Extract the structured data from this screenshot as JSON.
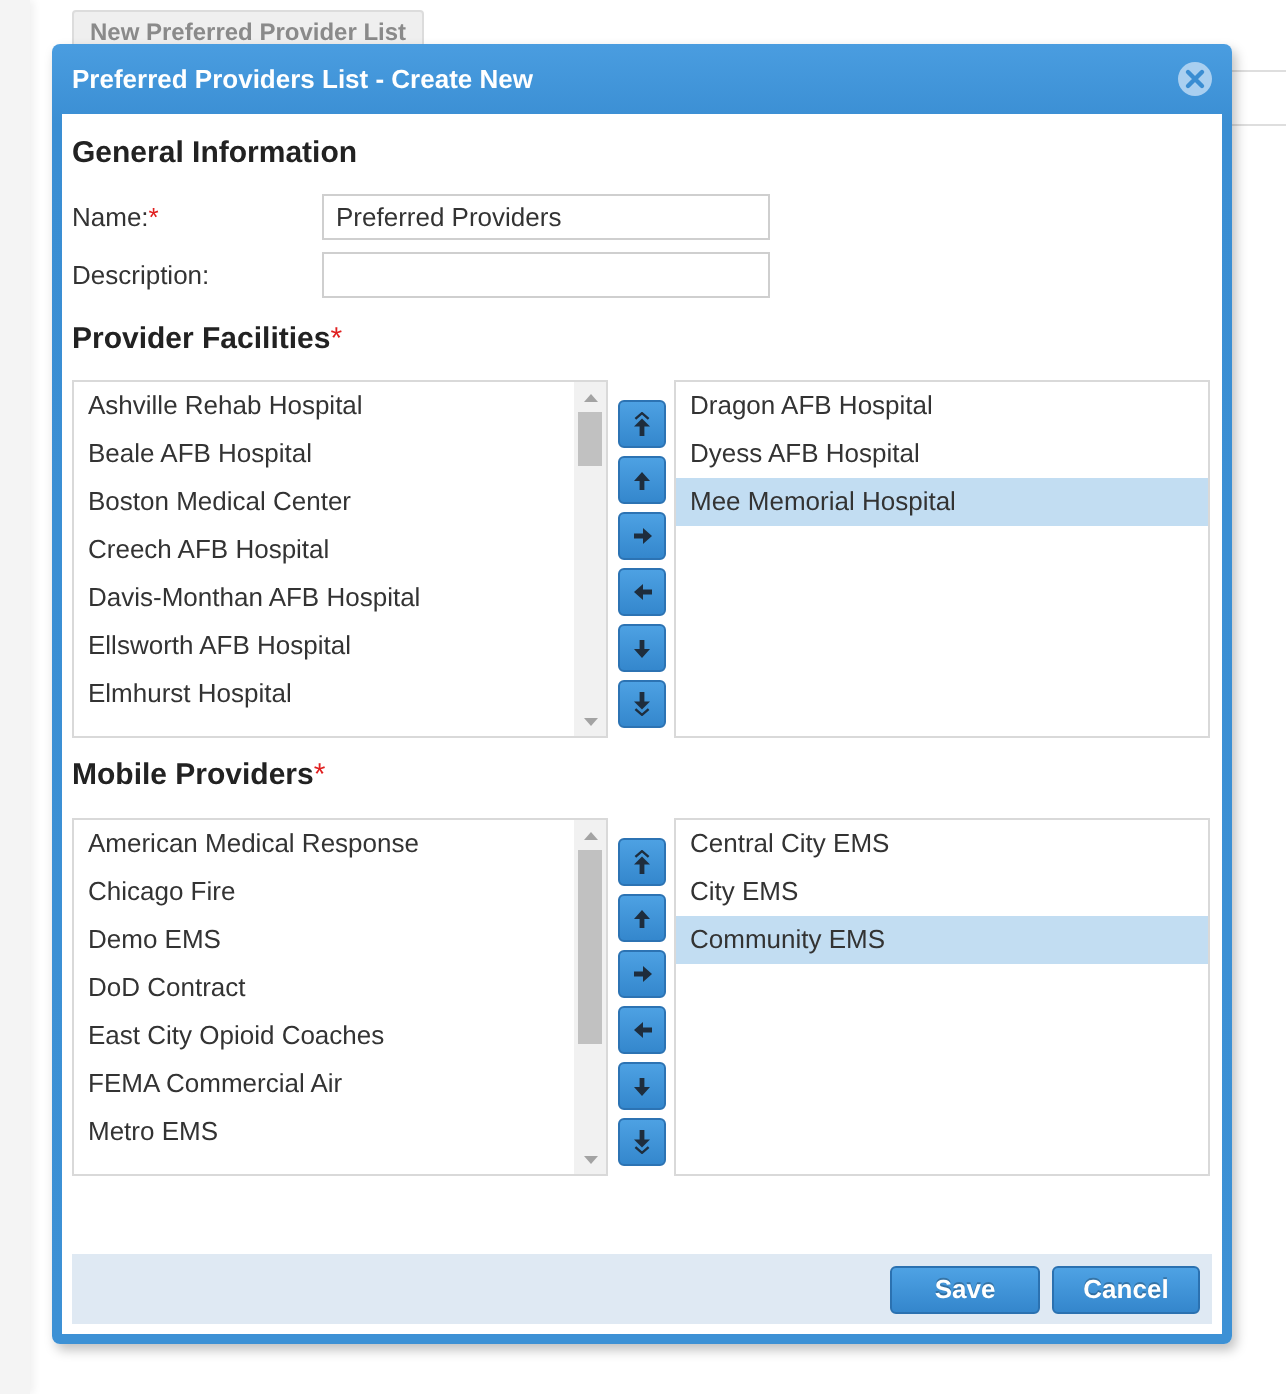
{
  "background": {
    "button": "New Preferred Provider List"
  },
  "dialog": {
    "title": "Preferred Providers List - Create New",
    "sections": [
      {
        "kind": "form",
        "heading": "General Information",
        "fields": [
          {
            "label": "Name:",
            "required_mark": "*",
            "value": "Preferred Providers"
          },
          {
            "label": "Description:"
          }
        ]
      },
      {
        "kind": "picklist",
        "heading": "Provider Facilities",
        "required_mark": "*",
        "available": [
          {
            "label": "Ashville Rehab Hospital",
            "selected": false
          },
          {
            "label": "Beale AFB Hospital",
            "selected": false
          },
          {
            "label": "Boston Medical Center",
            "selected": false
          },
          {
            "label": "Creech AFB Hospital",
            "selected": false
          },
          {
            "label": "Davis-Monthan AFB Hospital",
            "selected": false
          },
          {
            "label": "Ellsworth AFB Hospital",
            "selected": false
          },
          {
            "label": "Elmhurst Hospital",
            "selected": false
          }
        ],
        "chosen": [
          {
            "label": "Dragon AFB Hospital",
            "selected": false
          },
          {
            "label": "Dyess AFB Hospital",
            "selected": false
          },
          {
            "label": "Mee Memorial Hospital",
            "selected": true
          }
        ]
      },
      {
        "kind": "picklist",
        "heading": "Mobile Providers",
        "required_mark": "*",
        "available": [
          {
            "label": "American Medical Response",
            "selected": false
          },
          {
            "label": "Chicago Fire",
            "selected": false
          },
          {
            "label": "Demo EMS",
            "selected": false
          },
          {
            "label": "DoD Contract",
            "selected": false
          },
          {
            "label": "East City Opioid Coaches",
            "selected": false
          },
          {
            "label": "FEMA Commercial Air",
            "selected": false
          },
          {
            "label": "Metro EMS",
            "selected": false
          }
        ],
        "chosen": [
          {
            "label": "Central City EMS",
            "selected": false
          },
          {
            "label": "City EMS",
            "selected": false
          },
          {
            "label": "Community EMS",
            "selected": true
          }
        ]
      }
    ],
    "buttons": [
      "Save",
      "Cancel"
    ]
  }
}
